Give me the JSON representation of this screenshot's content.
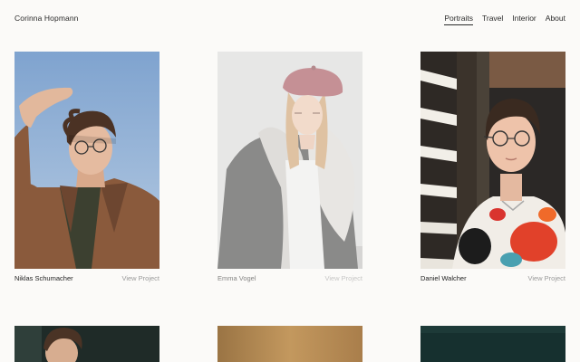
{
  "site": {
    "title": "Corinna Hopmann"
  },
  "nav": {
    "items": [
      {
        "label": "Portraits",
        "active": true
      },
      {
        "label": "Travel",
        "active": false
      },
      {
        "label": "Interior",
        "active": false
      },
      {
        "label": "About",
        "active": false
      }
    ]
  },
  "projects": [
    {
      "name": "Niklas Schumacher",
      "link": "View Project"
    },
    {
      "name": "Emma Vogel",
      "link": "View Project"
    },
    {
      "name": "Daniel Walcher",
      "link": "View Project"
    }
  ],
  "colors": {
    "background": "#fbfaf8",
    "text": "#222222",
    "muted": "#9a9a9a"
  }
}
